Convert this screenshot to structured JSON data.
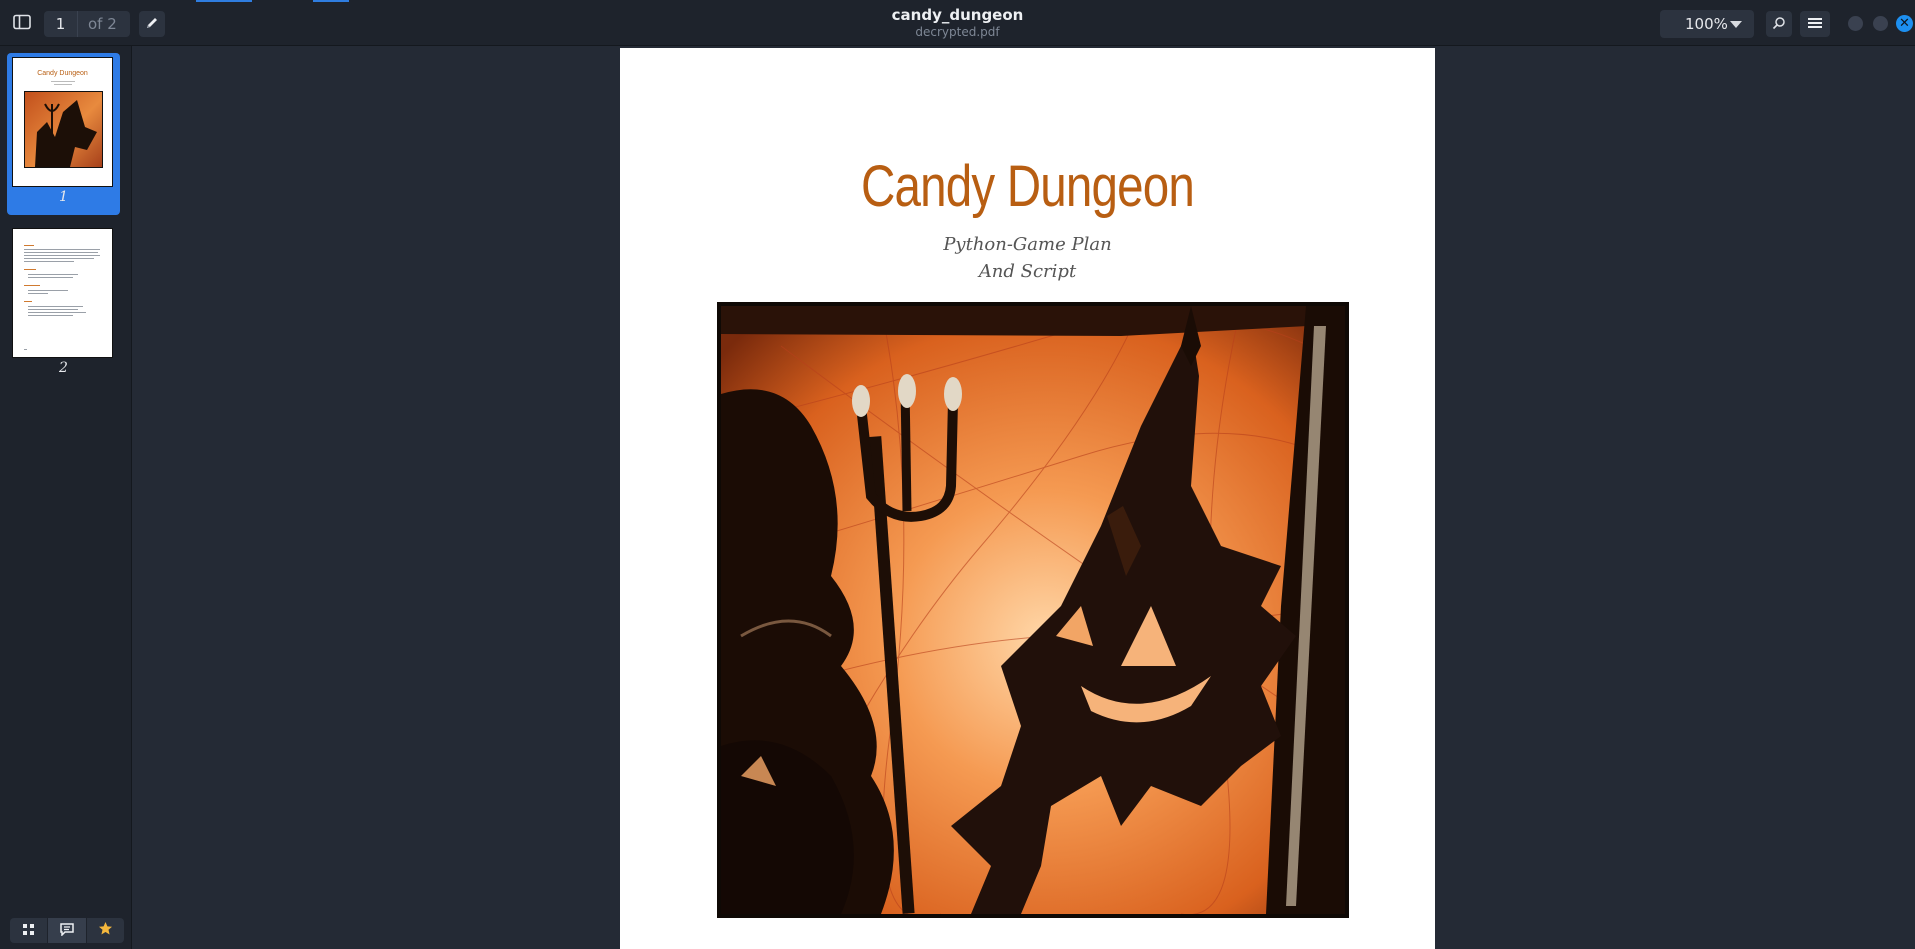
{
  "header": {
    "current_page": "1",
    "page_total": "of 2",
    "title": "candy_dungeon",
    "filename": "decrypted.pdf",
    "zoom": "100%"
  },
  "sidebar": {
    "thumbnails": [
      {
        "label": "1",
        "active": true
      },
      {
        "label": "2",
        "active": false
      }
    ],
    "thumb1_title": "Candy Dungeon"
  },
  "document": {
    "title": "Candy Dungeon",
    "subtitle_line1": "Python-Game Plan",
    "subtitle_line2": "And Script"
  },
  "colors": {
    "accent": "#2e7be6",
    "title_orange": "#b85e12",
    "background": "#242a35",
    "chrome": "#1e232c"
  }
}
